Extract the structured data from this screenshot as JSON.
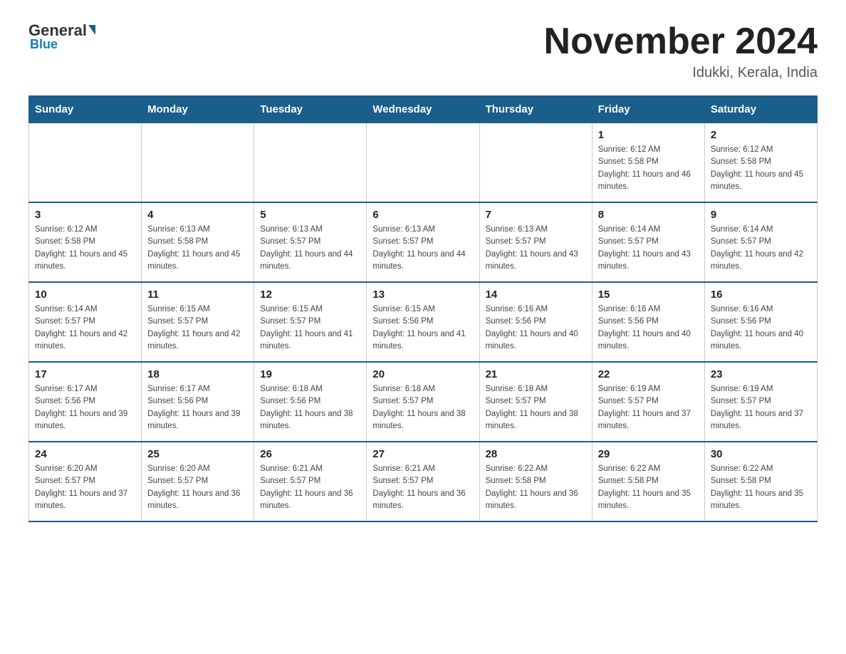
{
  "logo": {
    "general": "General",
    "triangle": "",
    "blue": "Blue"
  },
  "header": {
    "title": "November 2024",
    "subtitle": "Idukki, Kerala, India"
  },
  "weekdays": [
    "Sunday",
    "Monday",
    "Tuesday",
    "Wednesday",
    "Thursday",
    "Friday",
    "Saturday"
  ],
  "weeks": [
    [
      {
        "day": "",
        "info": ""
      },
      {
        "day": "",
        "info": ""
      },
      {
        "day": "",
        "info": ""
      },
      {
        "day": "",
        "info": ""
      },
      {
        "day": "",
        "info": ""
      },
      {
        "day": "1",
        "info": "Sunrise: 6:12 AM\nSunset: 5:58 PM\nDaylight: 11 hours and 46 minutes."
      },
      {
        "day": "2",
        "info": "Sunrise: 6:12 AM\nSunset: 5:58 PM\nDaylight: 11 hours and 45 minutes."
      }
    ],
    [
      {
        "day": "3",
        "info": "Sunrise: 6:12 AM\nSunset: 5:58 PM\nDaylight: 11 hours and 45 minutes."
      },
      {
        "day": "4",
        "info": "Sunrise: 6:13 AM\nSunset: 5:58 PM\nDaylight: 11 hours and 45 minutes."
      },
      {
        "day": "5",
        "info": "Sunrise: 6:13 AM\nSunset: 5:57 PM\nDaylight: 11 hours and 44 minutes."
      },
      {
        "day": "6",
        "info": "Sunrise: 6:13 AM\nSunset: 5:57 PM\nDaylight: 11 hours and 44 minutes."
      },
      {
        "day": "7",
        "info": "Sunrise: 6:13 AM\nSunset: 5:57 PM\nDaylight: 11 hours and 43 minutes."
      },
      {
        "day": "8",
        "info": "Sunrise: 6:14 AM\nSunset: 5:57 PM\nDaylight: 11 hours and 43 minutes."
      },
      {
        "day": "9",
        "info": "Sunrise: 6:14 AM\nSunset: 5:57 PM\nDaylight: 11 hours and 42 minutes."
      }
    ],
    [
      {
        "day": "10",
        "info": "Sunrise: 6:14 AM\nSunset: 5:57 PM\nDaylight: 11 hours and 42 minutes."
      },
      {
        "day": "11",
        "info": "Sunrise: 6:15 AM\nSunset: 5:57 PM\nDaylight: 11 hours and 42 minutes."
      },
      {
        "day": "12",
        "info": "Sunrise: 6:15 AM\nSunset: 5:57 PM\nDaylight: 11 hours and 41 minutes."
      },
      {
        "day": "13",
        "info": "Sunrise: 6:15 AM\nSunset: 5:56 PM\nDaylight: 11 hours and 41 minutes."
      },
      {
        "day": "14",
        "info": "Sunrise: 6:16 AM\nSunset: 5:56 PM\nDaylight: 11 hours and 40 minutes."
      },
      {
        "day": "15",
        "info": "Sunrise: 6:16 AM\nSunset: 5:56 PM\nDaylight: 11 hours and 40 minutes."
      },
      {
        "day": "16",
        "info": "Sunrise: 6:16 AM\nSunset: 5:56 PM\nDaylight: 11 hours and 40 minutes."
      }
    ],
    [
      {
        "day": "17",
        "info": "Sunrise: 6:17 AM\nSunset: 5:56 PM\nDaylight: 11 hours and 39 minutes."
      },
      {
        "day": "18",
        "info": "Sunrise: 6:17 AM\nSunset: 5:56 PM\nDaylight: 11 hours and 39 minutes."
      },
      {
        "day": "19",
        "info": "Sunrise: 6:18 AM\nSunset: 5:56 PM\nDaylight: 11 hours and 38 minutes."
      },
      {
        "day": "20",
        "info": "Sunrise: 6:18 AM\nSunset: 5:57 PM\nDaylight: 11 hours and 38 minutes."
      },
      {
        "day": "21",
        "info": "Sunrise: 6:18 AM\nSunset: 5:57 PM\nDaylight: 11 hours and 38 minutes."
      },
      {
        "day": "22",
        "info": "Sunrise: 6:19 AM\nSunset: 5:57 PM\nDaylight: 11 hours and 37 minutes."
      },
      {
        "day": "23",
        "info": "Sunrise: 6:19 AM\nSunset: 5:57 PM\nDaylight: 11 hours and 37 minutes."
      }
    ],
    [
      {
        "day": "24",
        "info": "Sunrise: 6:20 AM\nSunset: 5:57 PM\nDaylight: 11 hours and 37 minutes."
      },
      {
        "day": "25",
        "info": "Sunrise: 6:20 AM\nSunset: 5:57 PM\nDaylight: 11 hours and 36 minutes."
      },
      {
        "day": "26",
        "info": "Sunrise: 6:21 AM\nSunset: 5:57 PM\nDaylight: 11 hours and 36 minutes."
      },
      {
        "day": "27",
        "info": "Sunrise: 6:21 AM\nSunset: 5:57 PM\nDaylight: 11 hours and 36 minutes."
      },
      {
        "day": "28",
        "info": "Sunrise: 6:22 AM\nSunset: 5:58 PM\nDaylight: 11 hours and 36 minutes."
      },
      {
        "day": "29",
        "info": "Sunrise: 6:22 AM\nSunset: 5:58 PM\nDaylight: 11 hours and 35 minutes."
      },
      {
        "day": "30",
        "info": "Sunrise: 6:22 AM\nSunset: 5:58 PM\nDaylight: 11 hours and 35 minutes."
      }
    ]
  ]
}
